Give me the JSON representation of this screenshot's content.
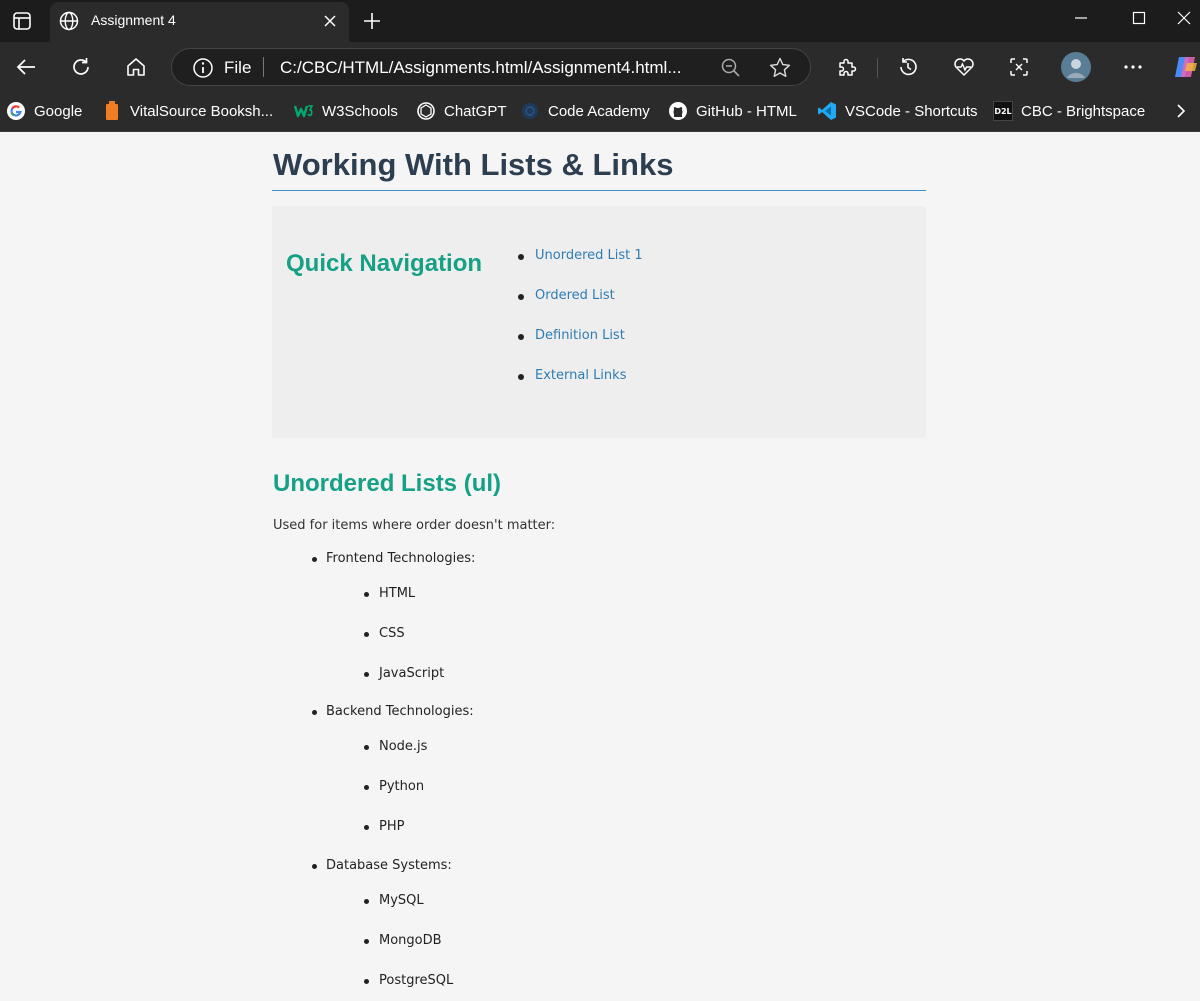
{
  "browser": {
    "tab_title": "Assignment 4",
    "address_scheme": "File",
    "address_url": "C:/CBC/HTML/Assignments.html/Assignment4.html...",
    "bookmarks": [
      {
        "label": "Google",
        "icon": "google-icon"
      },
      {
        "label": "VitalSource Booksh...",
        "icon": "vitalsource-icon"
      },
      {
        "label": "W3Schools",
        "icon": "w3schools-icon"
      },
      {
        "label": "ChatGPT",
        "icon": "chatgpt-icon"
      },
      {
        "label": "Code Academy",
        "icon": "codeacademy-icon"
      },
      {
        "label": "GitHub - HTML",
        "icon": "github-icon"
      },
      {
        "label": "VSCode - Shortcuts",
        "icon": "vscode-icon"
      },
      {
        "label": "CBC - Brightspace",
        "icon": "d2l-icon"
      }
    ],
    "d2l_badge": "D2L"
  },
  "page": {
    "title": "Working With Lists & Links",
    "quick_nav": {
      "title": "Quick Navigation",
      "links": [
        "Unordered List 1",
        "Ordered List",
        "Definition List",
        "External Links"
      ]
    },
    "unordered": {
      "title": "Unordered Lists (ul)",
      "description": "Used for items where order doesn't matter:",
      "groups": [
        {
          "label": "Frontend Technologies:",
          "items": [
            "HTML",
            "CSS",
            "JavaScript"
          ]
        },
        {
          "label": "Backend Technologies:",
          "items": [
            "Node.js",
            "Python",
            "PHP"
          ]
        },
        {
          "label": "Database Systems:",
          "items": [
            "MySQL",
            "MongoDB",
            "PostgreSQL"
          ]
        }
      ]
    }
  },
  "colors": {
    "heading": "#2c3e50",
    "accent_green": "#16a085",
    "link_blue": "#2f7cb3",
    "rule_blue": "#3a8fc6"
  }
}
